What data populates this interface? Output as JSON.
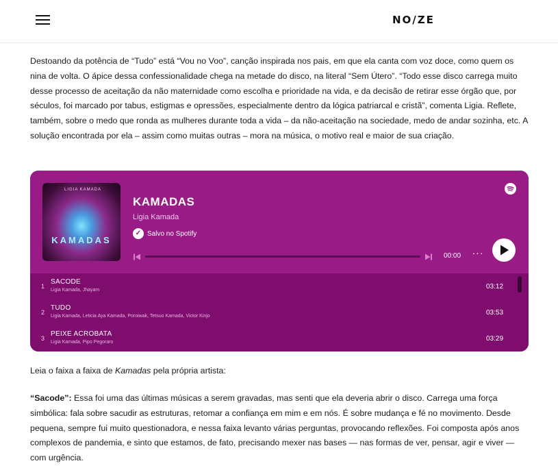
{
  "header": {
    "logo_text": "NO/ZE",
    "menu_icon": "hamburger-menu-icon"
  },
  "article": {
    "p1": "Destoando da potência de “Tudo” está “Vou no Voo”, canção inspirada nos pais, em que ela canta com voz doce, como quem os nina de volta. O ápice dessa confessionalidade chega na metade do disco, na literal “Sem Útero”. “Todo esse disco carrega muito desse processo de aceitação da não maternidade como escolha e prioridade na vida, e da decisão de retirar esse órgão que, por séculos, foi marcado por tabus, estigmas e opressões, especialmente dentro da lógica patriarcal e cristã”, comenta Ligia. Reflete, também, sobre o medo que ronda as mulheres durante toda a vida – da não-aceitação na sociedade, medo de andar sozinha, etc. A solução encontrada por ela – assim como muitas outras – mora na música, o motivo real e maior de sua criação.",
    "p2_start": "Leia o faixa a faixa de ",
    "p2_italic": "Kamadas",
    "p2_end": " pela própria artista:",
    "p3_bold": "“Sacode”:",
    "p3_text": " Essa foi uma das últimas músicas a serem gravadas, mas senti que ela deveria abrir o  disco. Carrega uma força simbólica: fala sobre sacudir as estruturas, retomar a confiança em mim e em nós. É sobre mudança e fé no movimento. Desde pequena, sempre fui muito  questionadora, e nessa faixa levanto várias perguntas, provocando reflexões. Foi composta após anos complexos de pandemia, e sinto que estamos, de fato, precisando mexer nas bases — nas formas de ver, pensar, agir e viver — com urgência."
  },
  "player": {
    "colors": {
      "top": "#981b86",
      "tracks": "#7e0d6d"
    },
    "cover": {
      "tagline": "LIGIA KAMADA",
      "title": "KAMADAS"
    },
    "album_title": "KAMADAS",
    "artist": "Ligia Kamada",
    "saved_label": "Salvo no Spotify",
    "time": "00:00",
    "more_label": "···",
    "icons": [
      "spotify-logo-icon",
      "check-icon",
      "previous-icon",
      "next-icon",
      "more-icon",
      "play-icon"
    ],
    "tracks": [
      {
        "num": "1",
        "name": "SACODE",
        "artists": "Ligia Kamada, Jhayam",
        "duration": "03:12"
      },
      {
        "num": "2",
        "name": "TUDO",
        "artists": "Ligia Kamada, Leticia Aya Kamada, Poroiwak, Tetsuo Kamada, Victor Kinjo",
        "duration": "03:53"
      },
      {
        "num": "3",
        "name": "PEIXE ACROBATA",
        "artists": "Ligia Kamada, Pipo Pegoraro",
        "duration": "03:29"
      }
    ]
  }
}
